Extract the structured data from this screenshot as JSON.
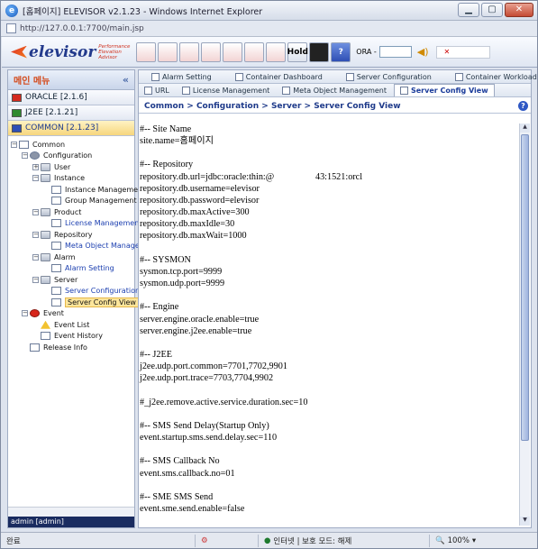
{
  "window": {
    "title": "[홈페이지] ELEVISOR v2.1.23 - Windows Internet Explorer",
    "minimize": "▁",
    "maximize": "▢",
    "close": "✕"
  },
  "address": {
    "url": "http://127.0.0.1:7700/main.jsp"
  },
  "toolbar": {
    "logo_text": "elevisor",
    "logo_tagline": "Performance Elevation Advisor",
    "icons": [
      "shield-icon",
      "monitor-icon",
      "grid-icon",
      "graph-icon",
      "chip-icon",
      "sql-icon",
      "box-icon",
      "hold-icon",
      "terminal-icon",
      "help-icon"
    ],
    "icon_labels": [
      "",
      "",
      "",
      "",
      "",
      "",
      "",
      "Hold",
      "",
      "?"
    ],
    "ora_label": "ORA -",
    "ora_value": "",
    "alarm_icon": "x-icon"
  },
  "left": {
    "menu_title": "메인 메뉴",
    "collapse": "«",
    "accordions": [
      {
        "label": "ORACLE [2.1.6]",
        "color": "#d42a1f"
      },
      {
        "label": "J2EE [2.1.21]",
        "color": "#2f8a2f"
      },
      {
        "label": "COMMON [2.1.23]",
        "color": "#2f4fb5"
      }
    ],
    "tree": [
      {
        "label": "Common",
        "depth": 0,
        "toggle": "−",
        "icon": "page"
      },
      {
        "label": "Configuration",
        "depth": 1,
        "toggle": "−",
        "icon": "gear"
      },
      {
        "label": "User",
        "depth": 2,
        "toggle": "+",
        "icon": "folder"
      },
      {
        "label": "Instance",
        "depth": 2,
        "toggle": "−",
        "icon": "folder"
      },
      {
        "label": "Instance Management",
        "depth": 3,
        "toggle": "",
        "icon": "page"
      },
      {
        "label": "Group Management",
        "depth": 3,
        "toggle": "",
        "icon": "page"
      },
      {
        "label": "Product",
        "depth": 2,
        "toggle": "−",
        "icon": "folder"
      },
      {
        "label": "License Management",
        "depth": 3,
        "toggle": "",
        "icon": "page",
        "link": true
      },
      {
        "label": "Repository",
        "depth": 2,
        "toggle": "−",
        "icon": "folder"
      },
      {
        "label": "Meta Object Management",
        "depth": 3,
        "toggle": "",
        "icon": "page",
        "link": true
      },
      {
        "label": "Alarm",
        "depth": 2,
        "toggle": "−",
        "icon": "folder"
      },
      {
        "label": "Alarm Setting",
        "depth": 3,
        "toggle": "",
        "icon": "page",
        "link": true
      },
      {
        "label": "Server",
        "depth": 2,
        "toggle": "−",
        "icon": "folder"
      },
      {
        "label": "Server Configuration",
        "depth": 3,
        "toggle": "",
        "icon": "page",
        "link": true
      },
      {
        "label": "Server Config View",
        "depth": 3,
        "toggle": "",
        "icon": "page",
        "selected": true
      },
      {
        "label": "Event",
        "depth": 1,
        "toggle": "−",
        "icon": "alert"
      },
      {
        "label": "Event List",
        "depth": 2,
        "toggle": "",
        "icon": "warn"
      },
      {
        "label": "Event History",
        "depth": 2,
        "toggle": "",
        "icon": "page"
      },
      {
        "label": "Release Info",
        "depth": 1,
        "toggle": "",
        "icon": "page"
      }
    ],
    "status_user": "admin [admin]"
  },
  "tabs": {
    "row1": [
      {
        "label": "Alarm Setting"
      },
      {
        "label": "Container Dashboard"
      },
      {
        "label": "Server Configuration"
      },
      {
        "label": "Container Workload"
      }
    ],
    "row2": [
      {
        "label": "URL"
      },
      {
        "label": "License Management"
      },
      {
        "label": "Meta Object Management"
      },
      {
        "label": "Server Config View",
        "active": true
      }
    ]
  },
  "breadcrumb": "Common > Configuration > Server > Server Config View",
  "config_text": "#-- Site Name\nsite.name=홈페이지\n\n#-- Repository\nrepository.db.url=jdbc:oracle:thin:@                  43:1521:orcl\nrepository.db.username=elevisor\nrepository.db.password=elevisor\nrepository.db.maxActive=300\nrepository.db.maxIdle=30\nrepository.db.maxWait=1000\n\n#-- SYSMON\nsysmon.tcp.port=9999\nsysmon.udp.port=9999\n\n#-- Engine\nserver.engine.oracle.enable=true\nserver.engine.j2ee.enable=true\n\n#-- J2EE\nj2ee.udp.port.common=7701,7702,9901\nj2ee.udp.port.trace=7703,7704,9902\n\n#_j2ee.remove.active.service.duration.sec=10\n\n#-- SMS Send Delay(Startup Only)\nevent.startup.sms.send.delay.sec=110\n\n#-- SMS Callback No\nevent.sms.callback.no=01\n\n#-- SME SMS Send\nevent.sme.send.enable=false",
  "statusbar": {
    "left": "완료",
    "zone": "인터넷 | 보호 모드: 해제",
    "zoom": "100%"
  }
}
